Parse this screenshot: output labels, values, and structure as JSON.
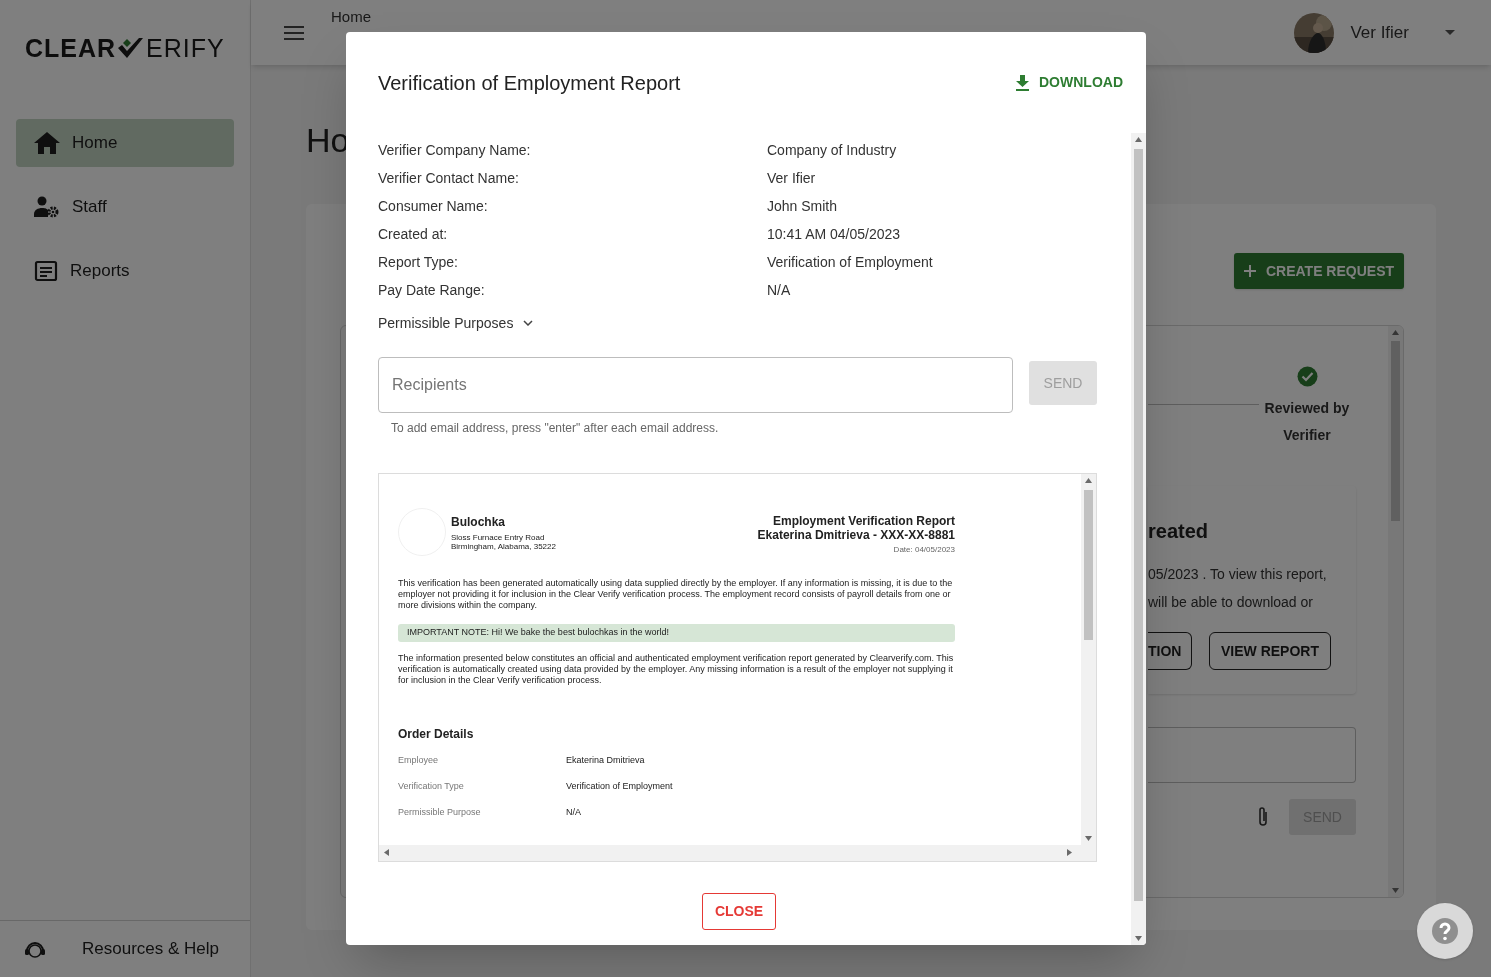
{
  "sidebar": {
    "logo": [
      "CLEAR",
      "ERIFY"
    ],
    "items": [
      {
        "label": "Home",
        "kind": "home",
        "selected": true
      },
      {
        "label": "Staff",
        "kind": "staff",
        "selected": false
      },
      {
        "label": "Reports",
        "kind": "reports",
        "selected": false
      }
    ],
    "footer": "Resources & Help"
  },
  "header": {
    "breadcrumb": "Home",
    "user": "Ver Ifier"
  },
  "page": {
    "heading": "Ho",
    "create_button": "CREATE REQUEST",
    "step": {
      "label": "Reviewed by Verifier",
      "done": true
    },
    "card": {
      "title": "reated",
      "lines": [
        "05/2023 . To view this report,",
        "will be able to download or"
      ],
      "buttons": [
        "TION",
        "VIEW REPORT"
      ]
    },
    "send": "SEND"
  },
  "modal": {
    "title": "Verification of Employment Report",
    "download": "DOWNLOAD",
    "details": [
      {
        "label": "Verifier Company Name:",
        "value": "Company of Industry"
      },
      {
        "label": "Verifier Contact Name:",
        "value": "Ver Ifier"
      },
      {
        "label": "Consumer Name:",
        "value": "John Smith"
      },
      {
        "label": "Created at:",
        "value": "10:41 AM 04/05/2023"
      },
      {
        "label": "Report Type:",
        "value": "Verification of Employment"
      },
      {
        "label": "Pay Date Range:",
        "value": "N/A"
      }
    ],
    "purposes": {
      "label": "Permissible Purposes",
      "expanded": false
    },
    "recipients": {
      "placeholder": "Recipients",
      "send": "SEND",
      "send_disabled": true,
      "hint": "To add email address, press \"enter\" after each email address."
    },
    "report": {
      "company": "Bulochka",
      "address": [
        "Sloss Furnace Entry Road",
        "Birmingham, Alabama, 35222"
      ],
      "title": "Employment Verification Report",
      "subject": "Ekaterina Dmitrieva - XXX-XX-8881",
      "date": "Date: 04/05/2023",
      "intro": "This verification has been generated automatically using data supplied directly by the employer. If any information is missing, it is due to the employer not providing it for inclusion in the Clear Verify verification process. The employment record consists of payroll details from one or more divisions within the company.",
      "note": "IMPORTANT NOTE: Hi! We bake the best bulochkas in the world!",
      "disclaimer": "The information presented below constitutes an official and authenticated employment verification report generated by Clearverify.com. This verification is automatically created using data provided by the employer. Any missing information is a result of the employer not supplying it for inclusion in the Clear Verify verification process.",
      "section": "Order Details",
      "rows": [
        {
          "label": "Employee",
          "value": "Ekaterina Dmitrieva"
        },
        {
          "label": "Verification Type",
          "value": "Verification of Employment"
        },
        {
          "label": "Permissible Purpose",
          "value": "N/A"
        }
      ]
    },
    "close": "CLOSE"
  }
}
